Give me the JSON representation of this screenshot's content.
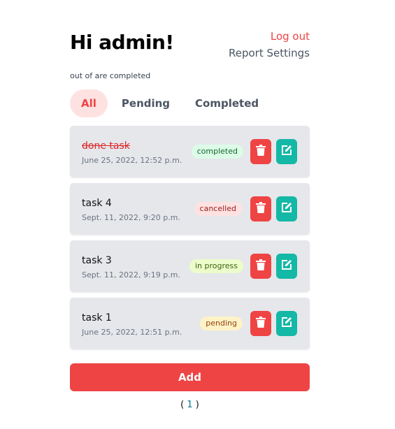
{
  "header": {
    "greeting": "Hi admin!",
    "logout": "Log out",
    "report_settings": "Report Settings"
  },
  "summary": "out of are completed",
  "tabs": [
    {
      "label": "All",
      "active": true
    },
    {
      "label": "Pending"
    },
    {
      "label": "Completed"
    }
  ],
  "tasks": [
    {
      "title": "done task",
      "date": "June 25, 2022, 12:52 p.m.",
      "status": "completed",
      "done": true
    },
    {
      "title": "task 4",
      "date": "Sept. 11, 2022, 9:20 p.m.",
      "status": "cancelled"
    },
    {
      "title": "task 3",
      "date": "Sept. 11, 2022, 9:19 p.m.",
      "status": "in progress"
    },
    {
      "title": "task 1",
      "date": "June 25, 2022, 12:51 p.m.",
      "status": "pending"
    }
  ],
  "status_colors": {
    "completed": {
      "bg": "#dcfce7",
      "fg": "#166534"
    },
    "cancelled": {
      "bg": "#fee2e2",
      "fg": "#991b1b"
    },
    "in progress": {
      "bg": "#ecfccb",
      "fg": "#3f6212"
    },
    "pending": {
      "bg": "#fef3c7",
      "fg": "#92400e"
    }
  },
  "add_label": "Add",
  "pagination": {
    "open": "(",
    "page": "1",
    "close": ")"
  }
}
